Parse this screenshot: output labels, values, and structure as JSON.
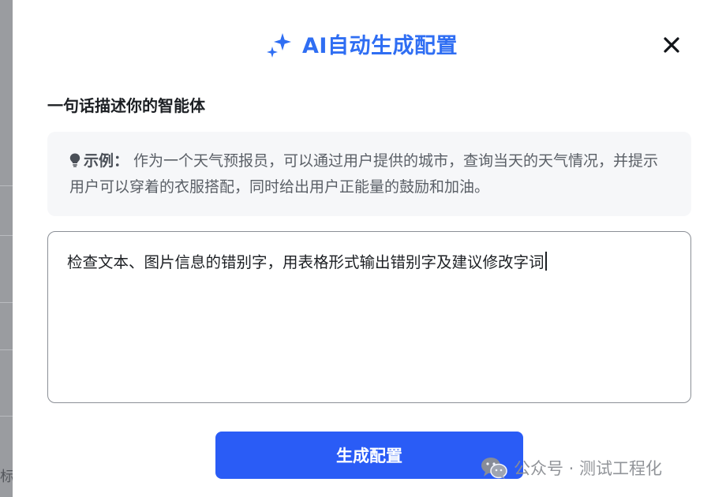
{
  "dialog": {
    "title": "AI自动生成配置",
    "title_icon": "sparkle-icon",
    "close_icon": "close-icon",
    "accent_color": "#2f6ef3",
    "section_label": "一句话描述你的智能体",
    "example": {
      "icon": "lightbulb-icon",
      "prefix": "示例：",
      "text": "作为一个天气预报员，可以通过用户提供的城市，查询当天的天气情况，并提示用户可以穿着的衣服搭配，同时给出用户正能量的鼓励和加油。"
    },
    "input": {
      "value": "检查文本、图片信息的错别字，用表格形式输出错别字及建议修改字词"
    },
    "generate_button": {
      "label": "生成配置",
      "color": "#2a5cf6"
    }
  },
  "background": {
    "edge_text": "标"
  },
  "watermark": {
    "icon": "wechat-icon",
    "text": "公众号 · 测试工程化"
  }
}
